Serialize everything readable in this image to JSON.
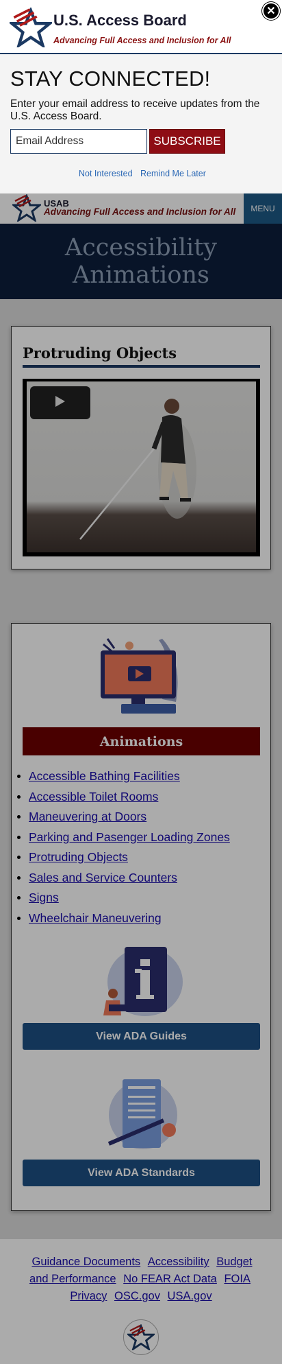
{
  "header": {
    "brand_short": "USAB",
    "tagline": "Advancing Full Access and Inclusion for All",
    "menu_label": "MENU"
  },
  "hero": {
    "title": "Accessibility Animations"
  },
  "video_card": {
    "title": "Protruding Objects"
  },
  "links_card": {
    "animations_heading": "Animations",
    "items": [
      "Accessible Bathing Facilities",
      "Accessible Toilet Rooms",
      "Maneuvering at Doors",
      "Parking and Pasenger Loading Zones",
      "Protruding Objects",
      "Sales and Service Counters",
      "Signs",
      "Wheelchair Maneuvering"
    ],
    "guides_button": "View ADA Guides",
    "standards_button": "View ADA Standards"
  },
  "footer": {
    "links": [
      "Guidance Documents",
      "Accessibility",
      "Budget and Performance",
      "No FEAR Act Data",
      "FOIA",
      "Privacy",
      "OSC.gov",
      "USA.gov"
    ]
  },
  "modal": {
    "org_name": "U.S. Access Board",
    "tagline": "Advancing Full Access and Inclusion for All",
    "heading": "STAY CONNECTED!",
    "description": "Enter your email address to receive updates from the U.S. Access Board.",
    "email_placeholder": "Email Address",
    "subscribe_label": "SUBSCRIBE",
    "not_interested": "Not Interested",
    "remind_later": "Remind Me Later",
    "close_icon": "close-icon"
  },
  "colors": {
    "navy": "#1c3a63",
    "maroon": "#8e0d14",
    "button_blue": "#1d4f83",
    "hero_bg": "#0d1e3c",
    "link": "#1a0dab"
  }
}
